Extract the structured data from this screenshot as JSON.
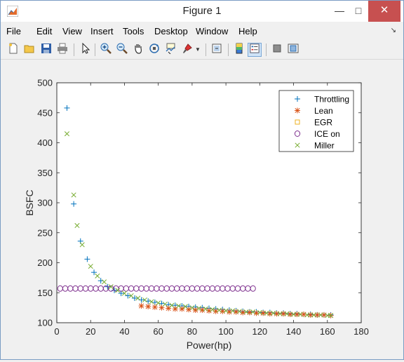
{
  "window": {
    "title": "Figure 1",
    "minimize_glyph": "—",
    "maximize_glyph": "□",
    "close_glyph": "✕"
  },
  "menu": {
    "items": [
      "File",
      "Edit",
      "View",
      "Insert",
      "Tools",
      "Desktop",
      "Window",
      "Help"
    ],
    "dock_arrow": "↘"
  },
  "toolbar": {
    "icons": [
      "new-figure-icon",
      "open-file-icon",
      "save-icon",
      "print-icon",
      "pointer-icon",
      "zoom-in-icon",
      "zoom-out-icon",
      "pan-icon",
      "rotate-3d-icon",
      "data-cursor-icon",
      "brush-icon",
      "brush-dropdown-icon",
      "link-plot-icon",
      "colorbar-icon",
      "legend-icon",
      "hide-plot-tools-icon",
      "show-plot-tools-icon"
    ]
  },
  "chart_data": {
    "type": "scatter",
    "xlabel": "Power(hp)",
    "ylabel": "BSFC",
    "xlim": [
      0,
      180
    ],
    "ylim": [
      100,
      500
    ],
    "xticks": [
      "0",
      "20",
      "40",
      "60",
      "80",
      "100",
      "120",
      "140",
      "160",
      "180"
    ],
    "yticks": [
      "100",
      "150",
      "200",
      "250",
      "300",
      "350",
      "400",
      "450",
      "500"
    ],
    "legend_position": "top-right",
    "series": [
      {
        "name": "Throttling",
        "marker": "+",
        "color": "#0072bd",
        "x": [
          6,
          10,
          14,
          18,
          22,
          26,
          30,
          34,
          38,
          42,
          46,
          50,
          54,
          58,
          62,
          66,
          70,
          74,
          78,
          82,
          86,
          90,
          94,
          98,
          102,
          106,
          110,
          114,
          118,
          122,
          126,
          130,
          134,
          138,
          142,
          146,
          150,
          154,
          158,
          162
        ],
        "y": [
          458,
          298,
          236,
          206,
          184,
          170,
          160,
          154,
          149,
          145,
          141,
          138,
          136,
          134,
          132,
          130,
          129,
          128,
          127,
          126,
          125,
          124,
          123,
          122,
          121,
          120,
          119,
          118,
          118,
          117,
          117,
          116,
          116,
          115,
          115,
          114,
          114,
          113,
          113,
          113
        ]
      },
      {
        "name": "Lean",
        "marker": "*",
        "color": "#d95319",
        "x": [
          50,
          54,
          58,
          62,
          66,
          70,
          74,
          78,
          82,
          86,
          90,
          94,
          98,
          102,
          106,
          110,
          114,
          118,
          122,
          126,
          130,
          134,
          138,
          142,
          146,
          150,
          154,
          158,
          162
        ],
        "y": [
          128,
          127,
          126,
          125,
          124,
          123,
          123,
          122,
          121,
          121,
          120,
          119,
          119,
          118,
          118,
          117,
          117,
          116,
          116,
          115,
          115,
          115,
          114,
          114,
          114,
          113,
          113,
          113,
          112
        ]
      },
      {
        "name": "EGR",
        "marker": "square",
        "color": "#edb120",
        "x": [],
        "y": []
      },
      {
        "name": "ICE on",
        "marker": "circle",
        "color": "#7e2f8e",
        "x": [
          2,
          5,
          8,
          11,
          14,
          17,
          20,
          23,
          26,
          29,
          32,
          35,
          38,
          41,
          44,
          47,
          50,
          53,
          56,
          59,
          62,
          65,
          68,
          71,
          74,
          77,
          80,
          83,
          86,
          89,
          92,
          95,
          98,
          101,
          104,
          107,
          110,
          113,
          116
        ],
        "y": [
          157,
          157,
          157,
          157,
          157,
          157,
          157,
          157,
          157,
          157,
          157,
          157,
          157,
          157,
          157,
          157,
          157,
          157,
          157,
          157,
          157,
          157,
          157,
          157,
          157,
          157,
          157,
          157,
          157,
          157,
          157,
          157,
          157,
          157,
          157,
          157,
          157,
          157,
          157
        ]
      },
      {
        "name": "Miller",
        "marker": "x",
        "color": "#77ac30",
        "x": [
          6,
          10,
          12,
          15,
          20,
          24,
          28,
          32,
          36,
          40,
          44,
          48,
          52,
          56,
          60,
          64,
          68,
          72,
          76,
          80,
          84,
          88,
          92,
          96,
          100,
          104,
          108,
          112,
          116,
          120,
          124,
          128,
          132,
          136,
          140,
          144,
          148,
          152,
          156,
          160,
          162
        ],
        "y": [
          415,
          313,
          262,
          230,
          194,
          178,
          168,
          160,
          154,
          149,
          145,
          141,
          138,
          135,
          133,
          131,
          129,
          128,
          127,
          125,
          124,
          123,
          122,
          121,
          120,
          120,
          119,
          118,
          118,
          117,
          116,
          116,
          115,
          115,
          114,
          114,
          113,
          113,
          113,
          112,
          112
        ]
      }
    ]
  }
}
